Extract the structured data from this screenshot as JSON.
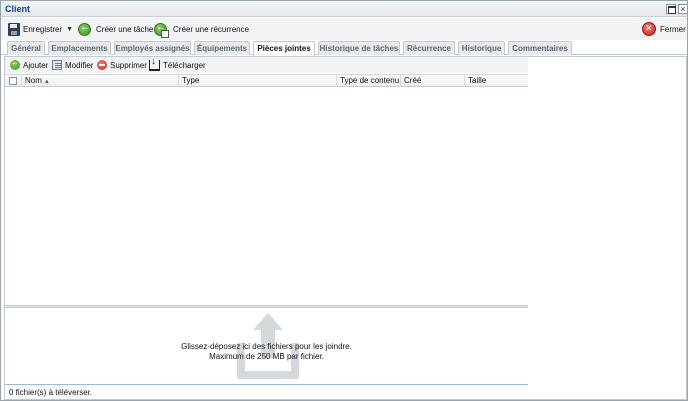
{
  "window": {
    "title": "Client"
  },
  "toolbar": {
    "save_label": "Enregistrer",
    "create_task_label": "Créer une tâche",
    "create_recurrence_label": "Créer une récurrence",
    "close_label": "Fermer"
  },
  "tabs": [
    {
      "label": "Général"
    },
    {
      "label": "Emplacements"
    },
    {
      "label": "Employés assignés"
    },
    {
      "label": "Équipements"
    },
    {
      "label": "Pièces jointes",
      "active": true
    },
    {
      "label": "Historique de tâches"
    },
    {
      "label": "Récurrence"
    },
    {
      "label": "Historique"
    },
    {
      "label": "Commentaires"
    }
  ],
  "attachments": {
    "toolbar": {
      "add_label": "Ajouter",
      "edit_label": "Modifier",
      "delete_label": "Supprimer",
      "download_label": "Télécharger"
    },
    "columns": [
      "Nom",
      "Type",
      "Type de contenu",
      "Créé",
      "Taille"
    ],
    "rows": [],
    "dropzone": {
      "line1": "Glissez-déposez ici des fichiers pour les joindre.",
      "line2": "Maximum de 250 MB par fichier."
    },
    "status": "0 fichier(s) à téléverser."
  },
  "colors": {
    "title_text": "#15428b",
    "border": "#c3c9cf",
    "upload_arrow": "#d6d9dc"
  },
  "icons": {
    "save": "save-icon",
    "create_task": "green-arrow-circle-icon",
    "create_recurrence": "recurrence-icon",
    "close": "red-close-circle-icon",
    "add": "add-icon",
    "edit": "edit-icon",
    "delete": "delete-icon",
    "download": "download-icon",
    "upload": "upload-arrow-icon"
  }
}
